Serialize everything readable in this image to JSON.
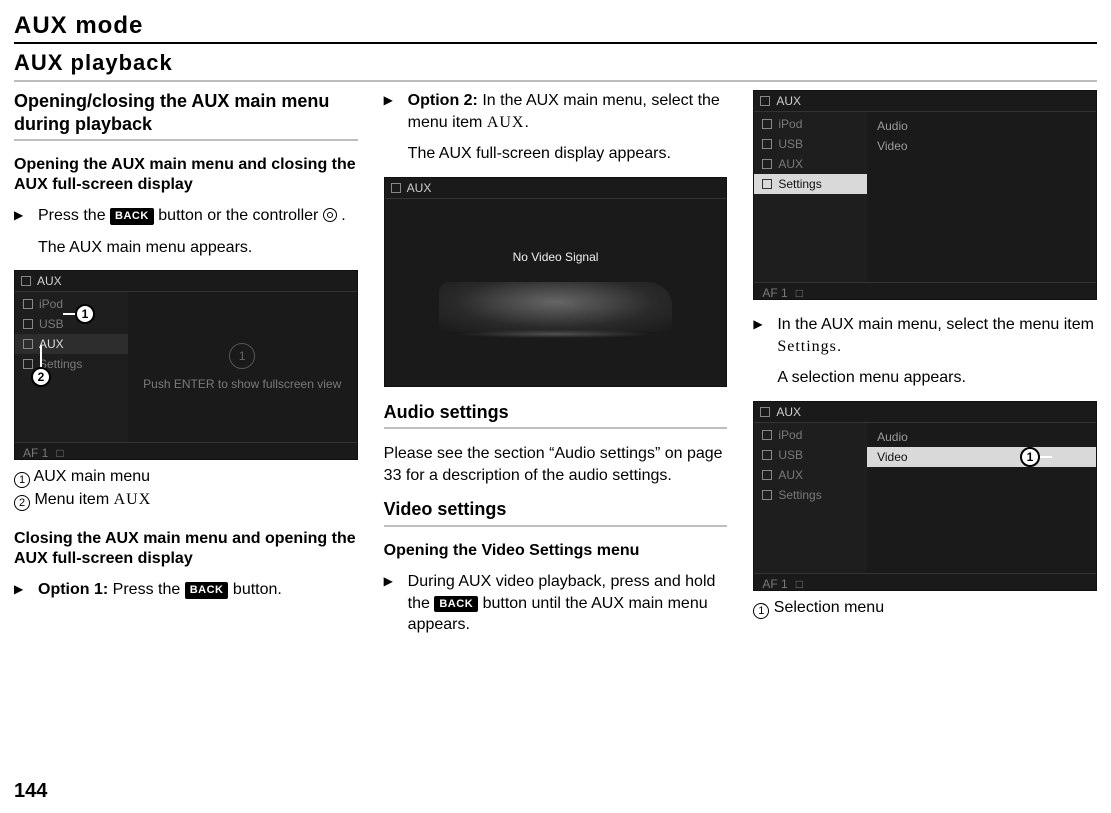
{
  "doc": {
    "title": "AUX mode",
    "section_title": "AUX playback",
    "page_number": "144"
  },
  "words": {
    "back": "BACK",
    "aux": "AUX",
    "settings": "Settings",
    "option1": "Option 1:",
    "option2": "Option 2:"
  },
  "col1": {
    "h3": "Opening/closing the AUX main menu during playback",
    "h4a": "Opening the AUX main menu and closing the AUX full-screen display",
    "step1_pre": "Press the ",
    "step1_mid": " button or the controller ",
    "step1_post": ".",
    "step1_result": "The AUX main menu appears.",
    "caption1": "AUX main menu",
    "caption2_pre": "Menu item ",
    "h4b": "Closing the AUX main menu and opening the AUX full-screen display",
    "step2_mid": " Press the ",
    "step2_post": " button."
  },
  "col2": {
    "opt2_a": "In the AUX main menu, select the menu item ",
    "opt2_b": ".",
    "opt2_result": "The AUX full-screen display appears.",
    "h3_audio": "Audio settings",
    "audio_p": "Please see the section “Audio settings” on page 33 for a description of the audio settings.",
    "h3_video": "Video settings",
    "h4_video": "Opening the Video Settings menu",
    "vstep_a": "During AUX video playback, press and hold the ",
    "vstep_b": " button until the AUX main menu appears."
  },
  "col3": {
    "step_a": "In the AUX main menu, select the menu item ",
    "step_b": ".",
    "result": "A selection menu appears.",
    "caption": "Selection menu"
  },
  "shots": {
    "title": "AUX",
    "side": {
      "ipod": "iPod",
      "usb": "USB",
      "aux": "AUX",
      "settings": "Settings"
    },
    "push_msg": "Push ENTER to show fullscreen view",
    "no_video": "No Video Signal",
    "audio": "Audio",
    "video": "Video",
    "bot": {
      "lab": "AF 1",
      "sq": "□"
    },
    "badge_1": "1",
    "badge_2": "2",
    "big_circ_1": "1"
  }
}
